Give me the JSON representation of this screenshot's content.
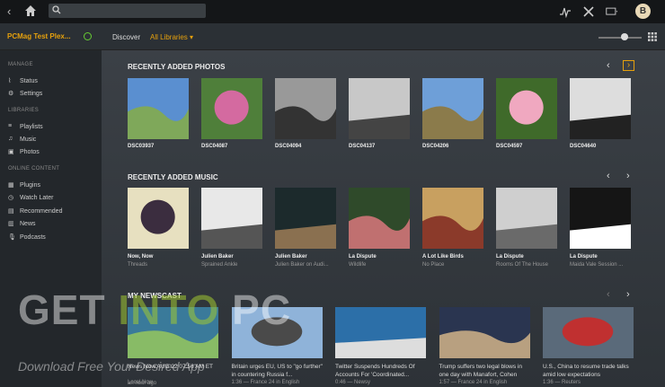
{
  "topbar": {
    "search_placeholder": "",
    "avatar_letter": "B"
  },
  "subbar": {
    "server_name": "PCMag Test Plex...",
    "discover": "Discover",
    "library_select": "All Libraries ▾"
  },
  "sidebar": {
    "manage_header": "MANAGE",
    "manage": [
      {
        "label": "Status",
        "icon": "pulse-icon"
      },
      {
        "label": "Settings",
        "icon": "gear-icon"
      }
    ],
    "libraries_header": "LIBRARIES",
    "libraries": [
      {
        "label": "Playlists",
        "icon": "list-icon"
      },
      {
        "label": "Music",
        "icon": "music-note-icon"
      },
      {
        "label": "Photos",
        "icon": "photo-icon"
      }
    ],
    "online_header": "ONLINE CONTENT",
    "online": [
      {
        "label": "Plugins",
        "icon": "puzzle-icon"
      },
      {
        "label": "Watch Later",
        "icon": "clock-icon"
      },
      {
        "label": "Recommended",
        "icon": "thumb-icon"
      },
      {
        "label": "News",
        "icon": "news-icon"
      },
      {
        "label": "Podcasts",
        "icon": "mic-icon"
      }
    ]
  },
  "photos": {
    "header": "RECENTLY ADDED PHOTOS",
    "items": [
      {
        "title": "DSC03937",
        "colors": [
          "#5a8fd0",
          "#7fa85a"
        ]
      },
      {
        "title": "DSC04087",
        "colors": [
          "#4f7f3a",
          "#d46aa0"
        ]
      },
      {
        "title": "DSC04094",
        "colors": [
          "#999999",
          "#333333"
        ]
      },
      {
        "title": "DSC04137",
        "colors": [
          "#c8c8c8",
          "#444444"
        ]
      },
      {
        "title": "DSC04206",
        "colors": [
          "#6e9fd8",
          "#8b7b4b"
        ]
      },
      {
        "title": "DSC04597",
        "colors": [
          "#3f6a2a",
          "#f0a8c0"
        ]
      },
      {
        "title": "DSC04640",
        "colors": [
          "#dddddd",
          "#222222"
        ]
      }
    ]
  },
  "music": {
    "header": "RECENTLY ADDED MUSIC",
    "items": [
      {
        "title": "Now, Now",
        "sub": "Threads",
        "colors": [
          "#e7e0c0",
          "#3b2d3f"
        ]
      },
      {
        "title": "Julien Baker",
        "sub": "Sprained Ankle",
        "colors": [
          "#e8e8e8",
          "#555555"
        ]
      },
      {
        "title": "Julien Baker",
        "sub": "Julien Baker on Audi...",
        "colors": [
          "#1c2a2c",
          "#8a7050"
        ]
      },
      {
        "title": "La Dispute",
        "sub": "Wildlife",
        "colors": [
          "#2f4a2a",
          "#c07070"
        ]
      },
      {
        "title": "A Lot Like Birds",
        "sub": "No Place",
        "colors": [
          "#c8a060",
          "#8b3a2a"
        ]
      },
      {
        "title": "La Dispute",
        "sub": "Rooms Of The House",
        "colors": [
          "#cfcfcf",
          "#6a6a6a"
        ]
      },
      {
        "title": "La Dispute",
        "sub": "Maida Vale Session ...",
        "colors": [
          "#151515",
          "#ffffff"
        ]
      }
    ]
  },
  "news": {
    "header": "MY NEWSCAST",
    "items": [
      {
        "title": "News Now AUG 22 07:56 AM ET",
        "sub": "Local Now",
        "colors": [
          "#3a7a9a",
          "#88bb66"
        ]
      },
      {
        "title": "Britain urges EU, US to \"go further\" in countering Russia f...",
        "sub": "1:36 — France 24 in English",
        "colors": [
          "#8fb3d9",
          "#4a4a4a"
        ]
      },
      {
        "title": "Twitter Suspends Hundreds Of Accounts For 'Coordinated...",
        "sub": "0:46 — Newsy",
        "colors": [
          "#2c6fa8",
          "#dddddd"
        ]
      },
      {
        "title": "Trump suffers two legal blows in one day with Manafort, Cohen",
        "sub": "1:57 — France 24 in English",
        "colors": [
          "#2a3550",
          "#b8a080"
        ]
      },
      {
        "title": "U.S., China to resume trade talks amid low expectations",
        "sub": "1:36 — Reuters",
        "colors": [
          "#5a6a7a",
          "#c03030"
        ]
      }
    ]
  },
  "watermark": {
    "big_a": "GET ",
    "big_b": "INTO",
    "big_c": " PC",
    "small": "Download Free Your Desired App"
  },
  "partial_texts": {
    "news_time": "an hour ago"
  }
}
